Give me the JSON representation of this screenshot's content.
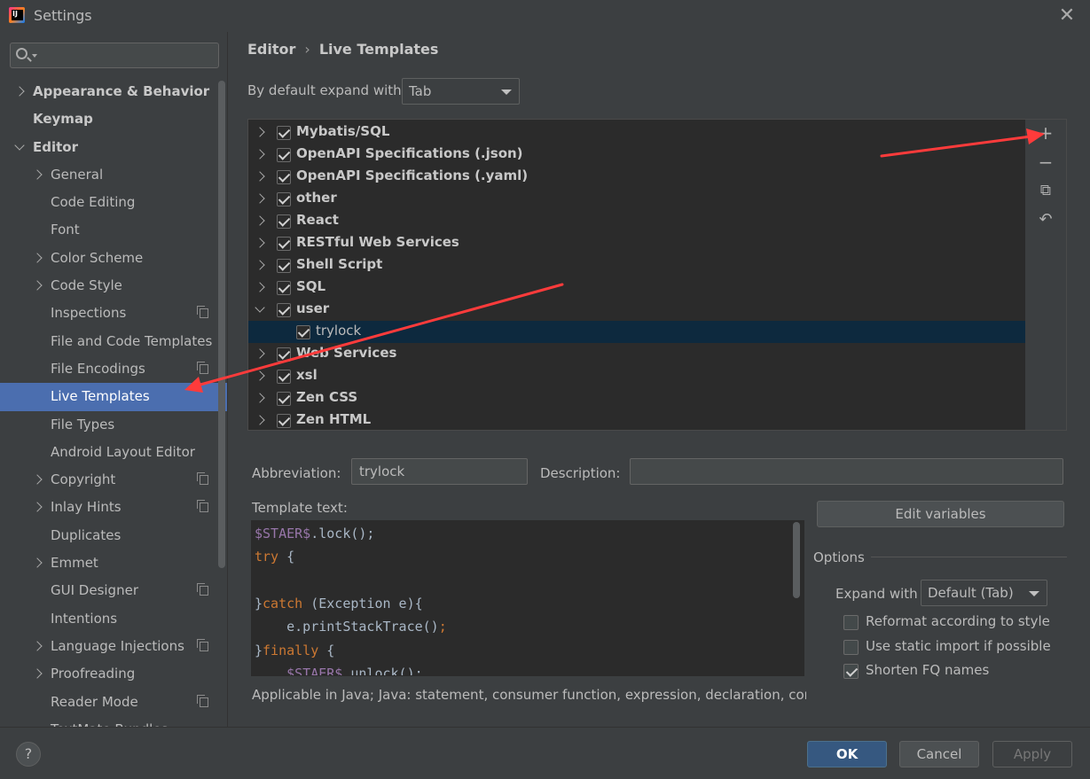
{
  "window": {
    "title": "Settings",
    "close_glyph": "✕"
  },
  "search": {
    "placeholder": ""
  },
  "sidebar": {
    "items": [
      {
        "label": "Appearance & Behavior",
        "level": 0,
        "chevron": "right",
        "bold": true
      },
      {
        "label": "Keymap",
        "level": 0,
        "chevron": "",
        "bold": true
      },
      {
        "label": "Editor",
        "level": 0,
        "chevron": "down",
        "bold": true
      },
      {
        "label": "General",
        "level": 1,
        "chevron": "right"
      },
      {
        "label": "Code Editing",
        "level": 1,
        "chevron": ""
      },
      {
        "label": "Font",
        "level": 1,
        "chevron": ""
      },
      {
        "label": "Color Scheme",
        "level": 1,
        "chevron": "right"
      },
      {
        "label": "Code Style",
        "level": 1,
        "chevron": "right"
      },
      {
        "label": "Inspections",
        "level": 1,
        "chevron": "",
        "project_icon": true
      },
      {
        "label": "File and Code Templates",
        "level": 1,
        "chevron": ""
      },
      {
        "label": "File Encodings",
        "level": 1,
        "chevron": "",
        "project_icon": true
      },
      {
        "label": "Live Templates",
        "level": 1,
        "chevron": "",
        "selected": true
      },
      {
        "label": "File Types",
        "level": 1,
        "chevron": ""
      },
      {
        "label": "Android Layout Editor",
        "level": 1,
        "chevron": ""
      },
      {
        "label": "Copyright",
        "level": 1,
        "chevron": "right",
        "project_icon": true
      },
      {
        "label": "Inlay Hints",
        "level": 1,
        "chevron": "right",
        "project_icon": true
      },
      {
        "label": "Duplicates",
        "level": 1,
        "chevron": ""
      },
      {
        "label": "Emmet",
        "level": 1,
        "chevron": "right"
      },
      {
        "label": "GUI Designer",
        "level": 1,
        "chevron": "",
        "project_icon": true
      },
      {
        "label": "Intentions",
        "level": 1,
        "chevron": ""
      },
      {
        "label": "Language Injections",
        "level": 1,
        "chevron": "right",
        "project_icon": true
      },
      {
        "label": "Proofreading",
        "level": 1,
        "chevron": "right"
      },
      {
        "label": "Reader Mode",
        "level": 1,
        "chevron": "",
        "project_icon": true
      },
      {
        "label": "TextMate Bundles",
        "level": 1,
        "chevron": ""
      }
    ]
  },
  "breadcrumb": {
    "parent": "Editor",
    "separator": "›",
    "current": "Live Templates"
  },
  "expand_default": {
    "label": "By default expand with",
    "value": "Tab"
  },
  "tree": {
    "rows": [
      {
        "label": "Mybatis/SQL",
        "expanded": false,
        "checked": true,
        "child": false
      },
      {
        "label": "OpenAPI Specifications (.json)",
        "expanded": false,
        "checked": true,
        "child": false
      },
      {
        "label": "OpenAPI Specifications (.yaml)",
        "expanded": false,
        "checked": true,
        "child": false
      },
      {
        "label": "other",
        "expanded": false,
        "checked": true,
        "child": false
      },
      {
        "label": "React",
        "expanded": false,
        "checked": true,
        "child": false
      },
      {
        "label": "RESTful Web Services",
        "expanded": false,
        "checked": true,
        "child": false
      },
      {
        "label": "Shell Script",
        "expanded": false,
        "checked": true,
        "child": false
      },
      {
        "label": "SQL",
        "expanded": false,
        "checked": true,
        "child": false
      },
      {
        "label": "user",
        "expanded": true,
        "checked": true,
        "child": false
      },
      {
        "label": "trylock",
        "expanded": false,
        "checked": true,
        "child": true,
        "selected": true
      },
      {
        "label": "Web Services",
        "expanded": false,
        "checked": true,
        "child": false
      },
      {
        "label": "xsl",
        "expanded": false,
        "checked": true,
        "child": false
      },
      {
        "label": "Zen CSS",
        "expanded": false,
        "checked": true,
        "child": false
      },
      {
        "label": "Zen HTML",
        "expanded": false,
        "checked": true,
        "child": false
      }
    ],
    "toolbar": {
      "add_glyph": "+",
      "remove_glyph": "−",
      "copy_glyph": "⧉",
      "restore_glyph": "↶"
    }
  },
  "details": {
    "abbreviation_label": "Abbreviation:",
    "abbreviation_value": "trylock",
    "description_label": "Description:",
    "description_value": "",
    "template_text_label": "Template text:",
    "code_lines": [
      [
        {
          "t": "$STAER$",
          "c": "var"
        },
        {
          "t": ".lock();",
          "c": ""
        }
      ],
      [
        {
          "t": "try",
          "c": "kw"
        },
        {
          "t": " {",
          "c": ""
        }
      ],
      [
        {
          "t": "",
          "c": ""
        }
      ],
      [
        {
          "t": "}",
          "c": ""
        },
        {
          "t": "catch",
          "c": "kw"
        },
        {
          "t": " (Exception e){",
          "c": ""
        }
      ],
      [
        {
          "t": "    e.printStackTrace()",
          "c": ""
        },
        {
          "t": ";",
          "c": "kw"
        }
      ],
      [
        {
          "t": "}",
          "c": ""
        },
        {
          "t": "finally",
          "c": "kw"
        },
        {
          "t": " {",
          "c": ""
        }
      ],
      [
        {
          "t": "    ",
          "c": ""
        },
        {
          "t": "$STAER$",
          "c": "var"
        },
        {
          "t": ".unlock();",
          "c": ""
        }
      ]
    ],
    "applicable": "Applicable in Java; Java: statement, consumer function, expression, declaration, comm",
    "edit_variables": "Edit variables"
  },
  "options": {
    "title": "Options",
    "expand_with_label": "Expand with",
    "expand_with_value": "Default (Tab)",
    "checkboxes": [
      {
        "label": "Reformat according to style",
        "checked": false
      },
      {
        "label": "Use static import if possible",
        "checked": false
      },
      {
        "label": "Shorten FQ names",
        "checked": true
      }
    ]
  },
  "footer": {
    "help": "?",
    "ok": "OK",
    "cancel": "Cancel",
    "apply": "Apply"
  },
  "colors": {
    "accent": "#4b6eaf",
    "background": "#3c3f41",
    "tree_bg": "#2b2b2b",
    "annotation": "#ff3b3b"
  }
}
